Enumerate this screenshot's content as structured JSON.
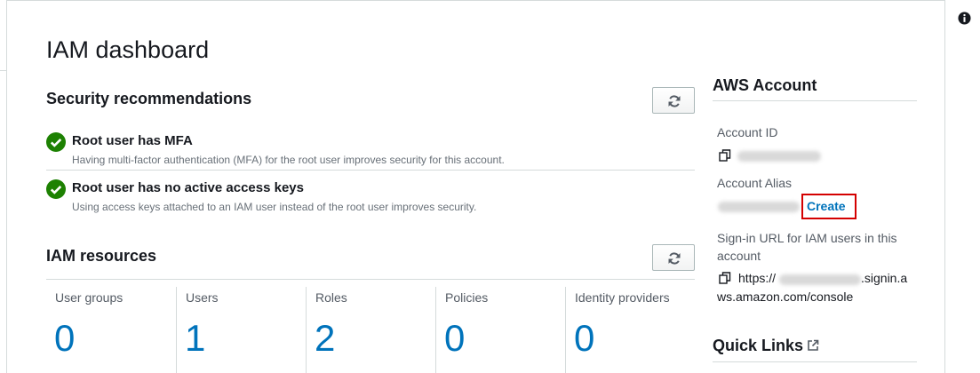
{
  "page": {
    "title": "IAM dashboard"
  },
  "security": {
    "title": "Security recommendations",
    "items": [
      {
        "title": "Root user has MFA",
        "description": "Having multi-factor authentication (MFA) for the root user improves security for this account."
      },
      {
        "title": "Root user has no active access keys",
        "description": "Using access keys attached to an IAM user instead of the root user improves security."
      }
    ]
  },
  "resources": {
    "title": "IAM resources",
    "items": [
      {
        "label": "User groups",
        "value": "0"
      },
      {
        "label": "Users",
        "value": "1"
      },
      {
        "label": "Roles",
        "value": "2"
      },
      {
        "label": "Policies",
        "value": "0"
      },
      {
        "label": "Identity providers",
        "value": "0"
      }
    ]
  },
  "account": {
    "title": "AWS Account",
    "id_label": "Account ID",
    "alias_label": "Account Alias",
    "create_label": "Create",
    "signin_label": "Sign-in URL for IAM users in this account",
    "url_prefix": "https://",
    "url_suffix": ".signin.a",
    "url_line2": "ws.amazon.com/console"
  },
  "quick_links": {
    "title": "Quick Links"
  },
  "icons": {
    "info": "info-icon",
    "refresh": "refresh-icon",
    "check": "check-circle-icon",
    "copy": "copy-icon",
    "external": "external-link-icon"
  },
  "colors": {
    "link": "#0073bb",
    "success": "#1d8102",
    "highlight": "#d40000"
  }
}
